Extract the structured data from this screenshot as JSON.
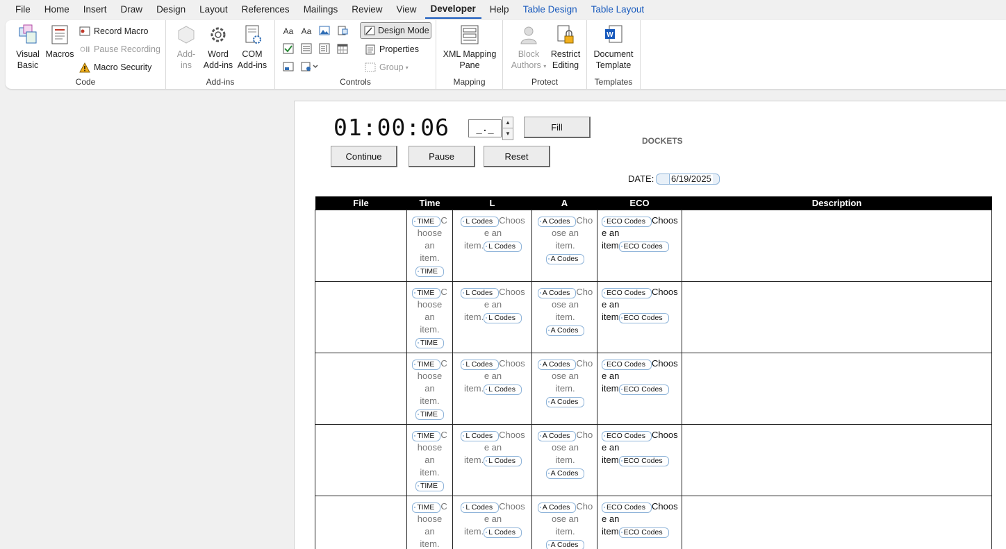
{
  "menu": {
    "items": [
      "File",
      "Home",
      "Insert",
      "Draw",
      "Design",
      "Layout",
      "References",
      "Mailings",
      "Review",
      "View",
      "Developer",
      "Help",
      "Table Design",
      "Table Layout"
    ],
    "active": "Developer"
  },
  "ribbon": {
    "code": {
      "label": "Code",
      "visual_basic_1": "Visual",
      "visual_basic_2": "Basic",
      "macros": "Macros",
      "record_macro": "Record Macro",
      "pause_recording": "Pause Recording",
      "macro_security": "Macro Security"
    },
    "addins": {
      "label": "Add-ins",
      "addins_1": "Add-",
      "addins_2": "ins",
      "word_addins_1": "Word",
      "word_addins_2": "Add-ins",
      "com_addins_1": "COM",
      "com_addins_2": "Add-ins"
    },
    "controls": {
      "label": "Controls",
      "design_mode": "Design Mode",
      "properties": "Properties",
      "group": "Group"
    },
    "mapping": {
      "label": "Mapping",
      "xml_1": "XML Mapping",
      "xml_2": "Pane"
    },
    "protect": {
      "label": "Protect",
      "block_1": "Block",
      "block_2": "Authors",
      "restrict_1": "Restrict",
      "restrict_2": "Editing"
    },
    "templates": {
      "label": "Templates",
      "doc_1": "Document",
      "doc_2": "Template"
    }
  },
  "document": {
    "timer": "01:00:06",
    "spin_value": "_._",
    "fill_button": "Fill",
    "continue_button": "Continue",
    "pause_button": "Pause",
    "reset_button": "Reset",
    "title": "DOCKETS",
    "date_label": "DATE:",
    "date_value": "6/19/2025"
  },
  "table": {
    "headers": [
      "File",
      "Time",
      "L",
      "A",
      "ECO",
      "Description"
    ],
    "tags": {
      "time": "TIME",
      "l": "L Codes",
      "a": "A Codes",
      "eco": "ECO Codes"
    },
    "time_ph": [
      "C",
      "hoose",
      "an",
      "item."
    ],
    "l_ph": [
      "Choos",
      "e an",
      "item."
    ],
    "a_ph": [
      "Cho",
      "ose an",
      "item."
    ],
    "eco_ph": [
      "Choos",
      "e an",
      "item"
    ],
    "row_count": 5
  },
  "colors": {
    "accent": "#185abd",
    "tag_border": "#8fb4d9",
    "header_bg": "#000000"
  }
}
